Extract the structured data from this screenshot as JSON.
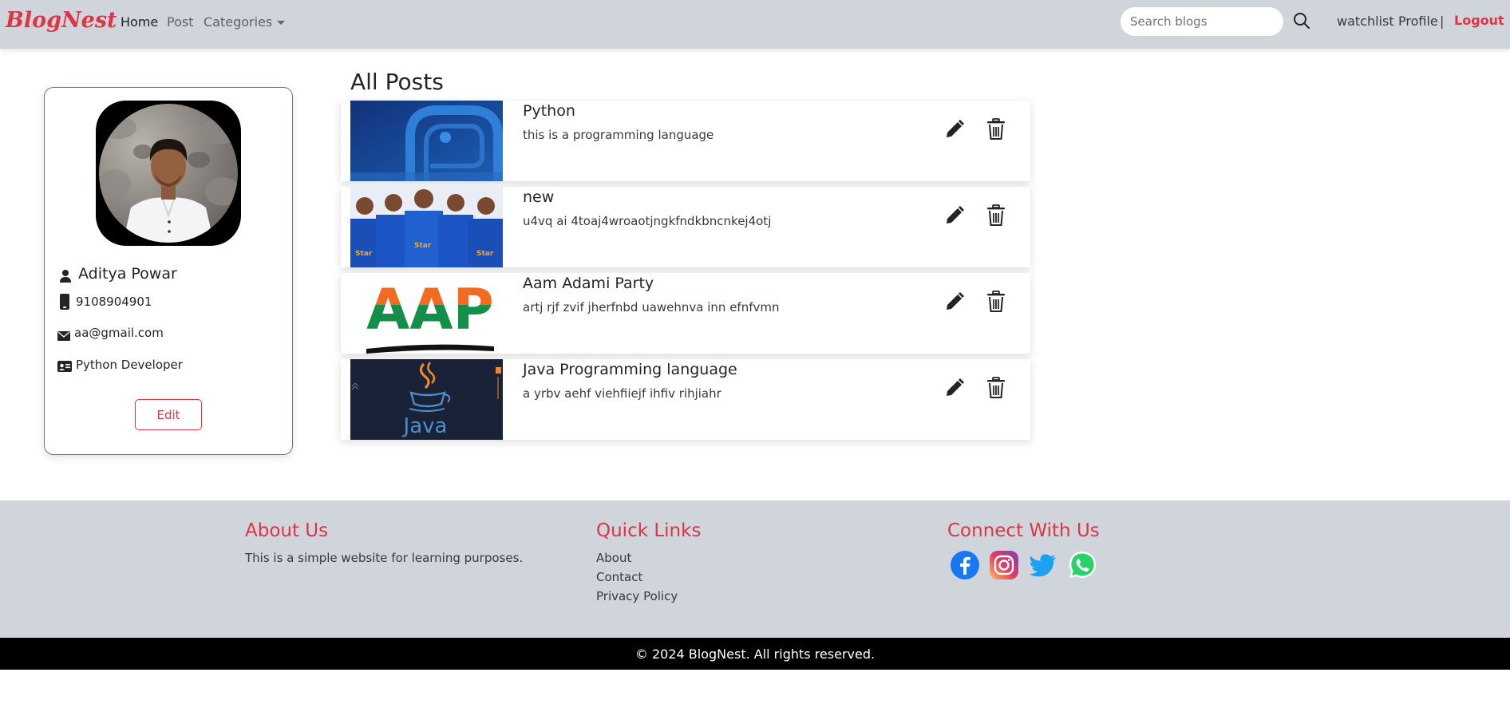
{
  "navbar": {
    "brand": "BlogNest",
    "links": [
      {
        "label": "Home",
        "active": true
      },
      {
        "label": "Post",
        "active": false
      },
      {
        "label": "Categories",
        "active": false
      }
    ],
    "search_placeholder": "Search blogs",
    "right_links": [
      "watchlist",
      "Profile"
    ],
    "separator": "|",
    "logout_label": "Logout"
  },
  "profile": {
    "name": "Aditya Powar",
    "phone": "9108904901",
    "email": "aa@gmail.com",
    "role": "Python Developer",
    "edit_label": "Edit"
  },
  "posts": {
    "heading": "All Posts",
    "items": [
      {
        "title": "Python",
        "description": "this is a programming language",
        "thumb": "python-logo"
      },
      {
        "title": "new",
        "description": "u4vq ai 4toaj4wroaotjngkfndkbncnkej4otj",
        "thumb": "cricket-team"
      },
      {
        "title": "Aam Adami Party",
        "description": "artj rjf zvif jherfnbd uawehnva inn efnfvmn",
        "thumb": "aap-logo",
        "thumb_text": "AAP"
      },
      {
        "title": "Java Programming language",
        "description": "a yrbv aehf viehfiiejf ihfiv rihjiahr",
        "thumb": "java-logo",
        "thumb_text": "Java"
      }
    ]
  },
  "footer": {
    "about": {
      "heading": "About Us",
      "text": "This is a simple website for learning purposes."
    },
    "quick_links": {
      "heading": "Quick Links",
      "items": [
        "About",
        "Contact",
        "Privacy Policy"
      ]
    },
    "connect": {
      "heading": "Connect With Us",
      "icons": [
        "facebook-icon",
        "instagram-icon",
        "twitter-icon",
        "whatsapp-icon"
      ]
    },
    "copyright": "© 2024 BlogNest. All rights reserved."
  },
  "colors": {
    "accent": "#dc3545",
    "navbar_bg": "#d0d4db",
    "footer_bg": "#d0d4db",
    "copyright_bg": "#000000"
  }
}
